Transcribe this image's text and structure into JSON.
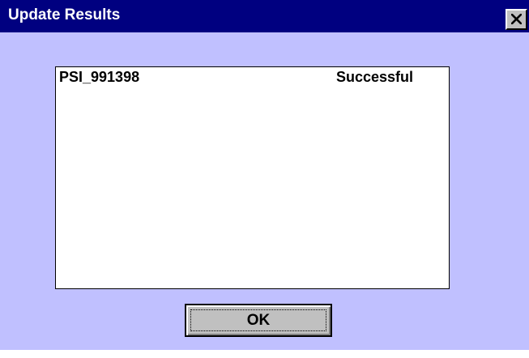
{
  "window": {
    "title": "Update Results",
    "close_icon": "close-icon"
  },
  "results": [
    {
      "name": "PSI_991398",
      "status": "Successful"
    }
  ],
  "buttons": {
    "ok_label": "OK"
  },
  "colors": {
    "titlebar": "#000080",
    "dialog_background": "#c0c0ff",
    "list_background": "#ffffff",
    "button_face": "#c0c0c0"
  }
}
